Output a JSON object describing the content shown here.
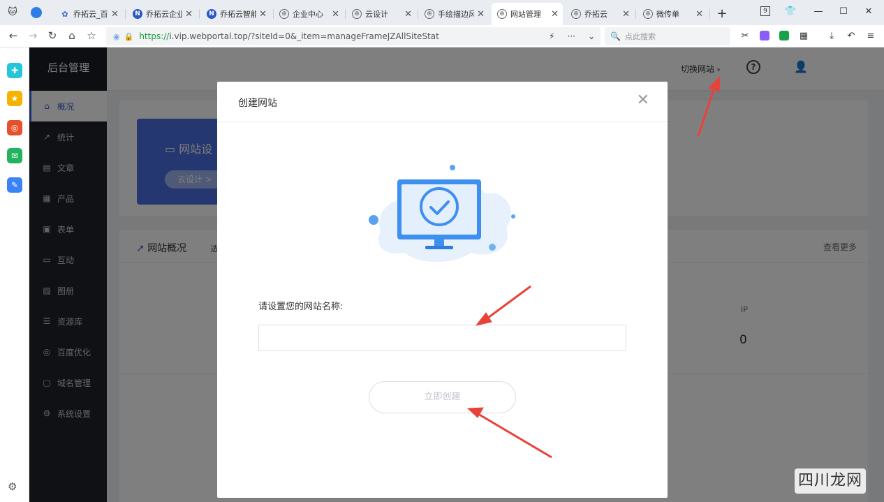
{
  "tabs": [
    {
      "label": "乔拓云_百",
      "icon": "paw-icon",
      "color": "#3b5fd6"
    },
    {
      "label": "乔拓云企业",
      "icon": "n-logo-icon",
      "color": "#2b57c9"
    },
    {
      "label": "乔拓云智能",
      "icon": "n-logo-icon",
      "color": "#2b57c9"
    },
    {
      "label": "企业中心",
      "icon": "globe-icon",
      "color": "#666666"
    },
    {
      "label": "云设计",
      "icon": "globe-icon",
      "color": "#666666"
    },
    {
      "label": "手绘描边风",
      "icon": "globe-icon",
      "color": "#666666"
    },
    {
      "label": "网站管理",
      "icon": "globe-icon",
      "color": "#666666",
      "active": true
    },
    {
      "label": "乔拓云",
      "icon": "globe-icon",
      "color": "#666666"
    },
    {
      "label": "微传单",
      "icon": "globe-icon",
      "color": "#666666"
    }
  ],
  "browser": {
    "badge": "9",
    "url_scheme": "https://",
    "url_rest": "i.vip.webportal.top/?siteId=0&_item=manageFrameJZAllSiteStat",
    "search_placeholder": "点此搜索"
  },
  "admin": {
    "brand": "后台管理",
    "nav": [
      {
        "label": "概况",
        "icon": "home-icon",
        "active": true
      },
      {
        "label": "统计",
        "icon": "chart-icon"
      },
      {
        "label": "文章",
        "icon": "article-icon"
      },
      {
        "label": "产品",
        "icon": "grid-icon"
      },
      {
        "label": "表单",
        "icon": "form-icon"
      },
      {
        "label": "互动",
        "icon": "comment-icon"
      },
      {
        "label": "图册",
        "icon": "album-icon"
      },
      {
        "label": "资源库",
        "icon": "database-icon"
      },
      {
        "label": "百度优化",
        "icon": "seo-icon"
      },
      {
        "label": "域名管理",
        "icon": "domain-icon"
      },
      {
        "label": "系统设置",
        "icon": "settings-icon"
      }
    ],
    "switch_site": "切换网站",
    "design_card_title": "网站设",
    "design_card_button": "去设计 >",
    "overview_title": "网站概况",
    "overview_tab_partial": "选",
    "more": "查看更多",
    "ip_label": "IP",
    "ip_value": "0"
  },
  "modal": {
    "title": "创建网站",
    "prompt": "请设置您的网站名称:",
    "input_value": "",
    "submit": "立即创建"
  },
  "watermark": "四川龙网",
  "colors": {
    "primary": "#3a5fcf",
    "nav_bg": "#1f2329",
    "arrow": "#e8423a"
  }
}
